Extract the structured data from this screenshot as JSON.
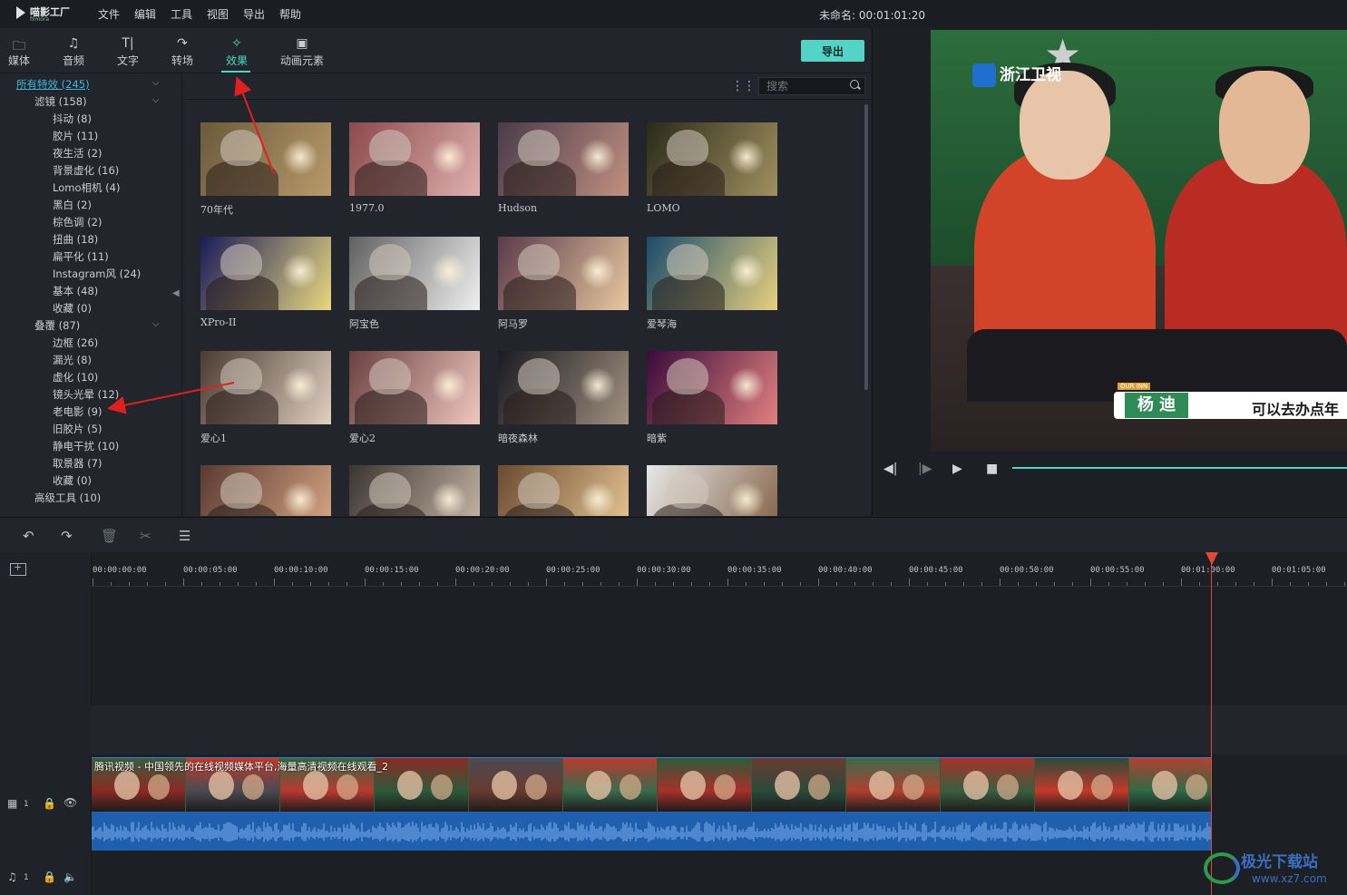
{
  "app": {
    "logo_text": "喵影工厂",
    "logo_sub": "filmora",
    "project_title": "未命名: 00:01:01:20"
  },
  "menu": [
    "文件",
    "编辑",
    "工具",
    "视图",
    "导出",
    "帮助"
  ],
  "tabs": [
    {
      "label": "媒体",
      "icon": "folder-icon"
    },
    {
      "label": "音频",
      "icon": "music-note-icon"
    },
    {
      "label": "文字",
      "icon": "text-icon"
    },
    {
      "label": "转场",
      "icon": "transition-icon"
    },
    {
      "label": "效果",
      "icon": "effects-icon",
      "active": true
    },
    {
      "label": "动画元素",
      "icon": "image-icon"
    }
  ],
  "export_label": "导出",
  "search": {
    "placeholder": "搜索"
  },
  "sidebar": [
    {
      "label": "所有特效 (245)",
      "level": 0,
      "selected": true,
      "chevron": true
    },
    {
      "label": "滤镜 (158)",
      "level": 1,
      "chevron": true
    },
    {
      "label": "抖动 (8)",
      "level": 2
    },
    {
      "label": "胶片 (11)",
      "level": 2
    },
    {
      "label": "夜生活 (2)",
      "level": 2
    },
    {
      "label": "背景虚化 (16)",
      "level": 2
    },
    {
      "label": "Lomo相机 (4)",
      "level": 2
    },
    {
      "label": "黑白 (2)",
      "level": 2
    },
    {
      "label": "棕色调 (2)",
      "level": 2
    },
    {
      "label": "扭曲 (18)",
      "level": 2
    },
    {
      "label": "扁平化 (11)",
      "level": 2
    },
    {
      "label": "Instagram风 (24)",
      "level": 2
    },
    {
      "label": "基本 (48)",
      "level": 2
    },
    {
      "label": "收藏 (0)",
      "level": 2
    },
    {
      "label": "叠覆 (87)",
      "level": 1,
      "chevron": true
    },
    {
      "label": "边框 (26)",
      "level": 2
    },
    {
      "label": "漏光 (8)",
      "level": 2
    },
    {
      "label": "虚化 (10)",
      "level": 2
    },
    {
      "label": "镜头光晕 (12)",
      "level": 2
    },
    {
      "label": "老电影 (9)",
      "level": 2
    },
    {
      "label": "旧胶片 (5)",
      "level": 2
    },
    {
      "label": "静电干扰 (10)",
      "level": 2
    },
    {
      "label": "取景器 (7)",
      "level": 2
    },
    {
      "label": "收藏 (0)",
      "level": 2
    },
    {
      "label": "高级工具 (10)",
      "level": 1
    }
  ],
  "effects": [
    {
      "label": "70年代",
      "colors": [
        "#6b5a3c",
        "#b89a6a"
      ]
    },
    {
      "label": "1977.0",
      "colors": [
        "#8a4a4a",
        "#e0b0b0"
      ]
    },
    {
      "label": "Hudson",
      "colors": [
        "#4a3a4a",
        "#c09080"
      ]
    },
    {
      "label": "LOMO",
      "colors": [
        "#2a2a1a",
        "#a09060"
      ]
    },
    {
      "label": "XPro-II",
      "colors": [
        "#1a1a5a",
        "#e8d880"
      ]
    },
    {
      "label": "阿宝色",
      "colors": [
        "#606060",
        "#f0f0f0"
      ]
    },
    {
      "label": "阿马罗",
      "colors": [
        "#5a3a4a",
        "#e8c8a0"
      ]
    },
    {
      "label": "爱琴海",
      "colors": [
        "#1a4a6a",
        "#e8d080"
      ]
    },
    {
      "label": "爱心1",
      "colors": [
        "#4a3a30",
        "#e0d0c0"
      ]
    },
    {
      "label": "爱心2",
      "colors": [
        "#6a4040",
        "#f0c8c0"
      ]
    },
    {
      "label": "暗夜森林",
      "colors": [
        "#1a1a20",
        "#a09080"
      ]
    },
    {
      "label": "暗紫",
      "colors": [
        "#3a0a3a",
        "#e08080"
      ]
    },
    {
      "label": "",
      "colors": [
        "#5a3a30",
        "#d0a080"
      ]
    },
    {
      "label": "",
      "colors": [
        "#3a3430",
        "#c0b0a0"
      ]
    },
    {
      "label": "",
      "colors": [
        "#6a4a30",
        "#e0c090"
      ]
    },
    {
      "label": "",
      "colors": [
        "#e8e8e8",
        "#8a6a50"
      ]
    }
  ],
  "preview": {
    "channel": "浙江卫视",
    "name_tag": "杨 迪",
    "caption": "可以去办点年",
    "badge": "OUR INN",
    "controls": [
      "prev-frame-icon",
      "next-frame-icon",
      "play-icon",
      "stop-icon"
    ]
  },
  "timeline": {
    "toolbar": [
      "undo-icon",
      "redo-icon",
      "delete-icon",
      "cut-icon",
      "adjust-icon"
    ],
    "ticks": [
      "00:00:00:00",
      "00:00:05:00",
      "00:00:10:00",
      "00:00:15:00",
      "00:00:20:00",
      "00:00:25:00",
      "00:00:30:00",
      "00:00:35:00",
      "00:00:40:00",
      "00:00:45:00",
      "00:00:50:00",
      "00:00:55:00",
      "00:01:00:00",
      "00:01:05:00"
    ],
    "clip_title": "腾讯视频 - 中国领先的在线视频媒体平台,海量高清视频在线观看_2",
    "video_track_num": "1",
    "audio_track_num": "1"
  },
  "watermark": {
    "text": "极光下载站",
    "url": "www.xz7.com"
  }
}
